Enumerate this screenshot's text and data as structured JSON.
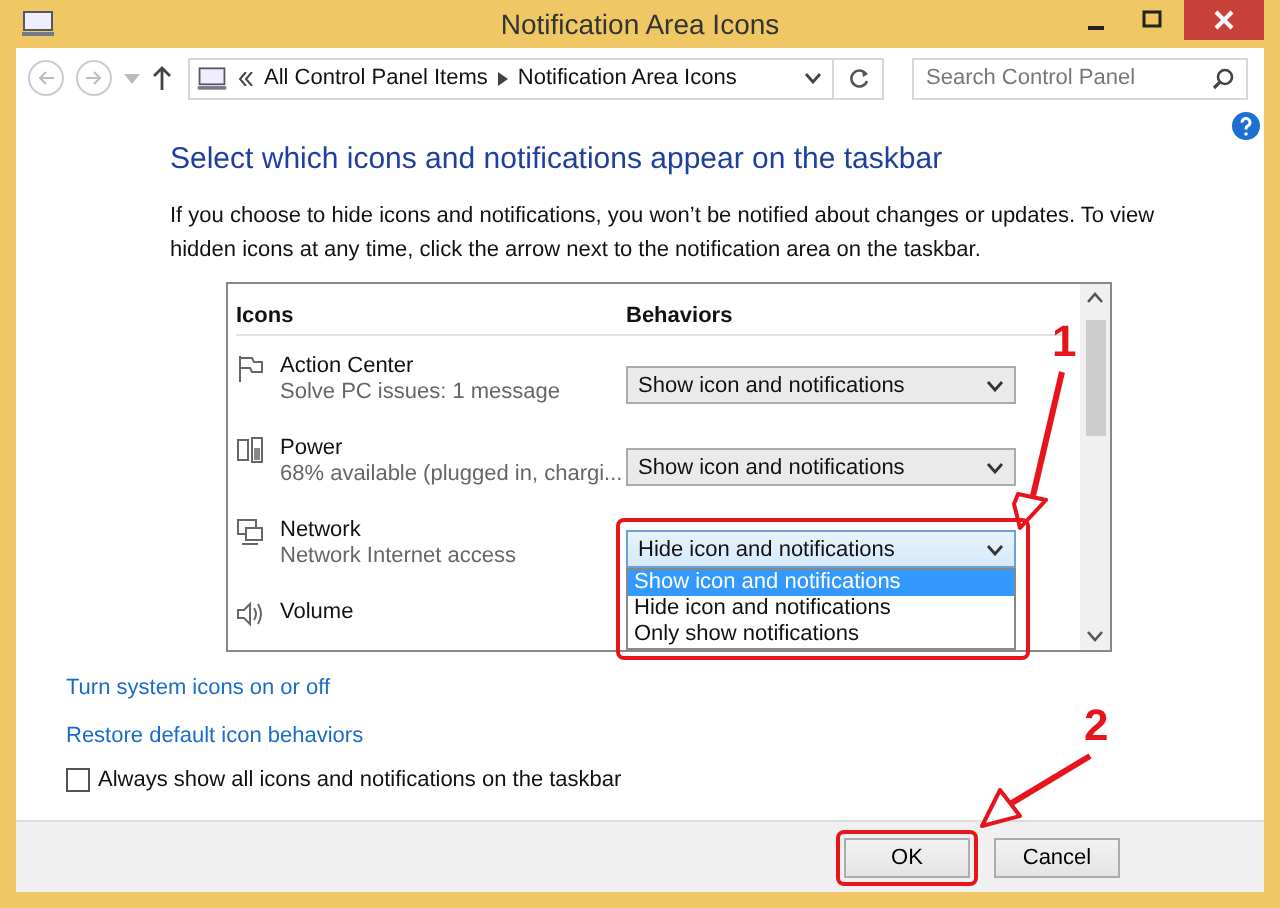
{
  "window": {
    "title": "Notification Area Icons"
  },
  "address_bar": {
    "breadcrumbs": [
      "All Control Panel Items",
      "Notification Area Icons"
    ]
  },
  "search": {
    "placeholder": "Search Control Panel"
  },
  "heading": "Select which icons and notifications appear on the taskbar",
  "description": "If you choose to hide icons and notifications, you won’t be notified about changes or updates. To view hidden icons at any time, click the arrow next to the notification area on the taskbar.",
  "table": {
    "columns": [
      "Icons",
      "Behaviors"
    ],
    "rows": [
      {
        "kind": "flag",
        "name": "Action Center",
        "status": "Solve PC issues: 1 message",
        "behavior": "Show icon and notifications",
        "expanded": false
      },
      {
        "kind": "power",
        "name": "Power",
        "status": "68% available (plugged in, chargi...",
        "behavior": "Show icon and notifications",
        "expanded": false
      },
      {
        "kind": "network",
        "name": "Network",
        "status": "Network Internet access",
        "behavior": "Hide icon and notifications",
        "expanded": true,
        "options": [
          {
            "label": "Show icon and notifications",
            "selected": true
          },
          {
            "label": "Hide icon and notifications",
            "selected": false
          },
          {
            "label": "Only show notifications",
            "selected": false
          }
        ]
      },
      {
        "kind": "volume",
        "name": "Volume"
      }
    ]
  },
  "links": [
    "Turn system icons on or off",
    "Restore default icon behaviors"
  ],
  "checkbox": {
    "label": "Always show all icons and notifications on the taskbar",
    "checked": false
  },
  "buttons": [
    {
      "label": "OK",
      "highlighted": true
    },
    {
      "label": "Cancel",
      "highlighted": false
    }
  ],
  "annotations": [
    {
      "label": "1"
    },
    {
      "label": "2"
    }
  ]
}
